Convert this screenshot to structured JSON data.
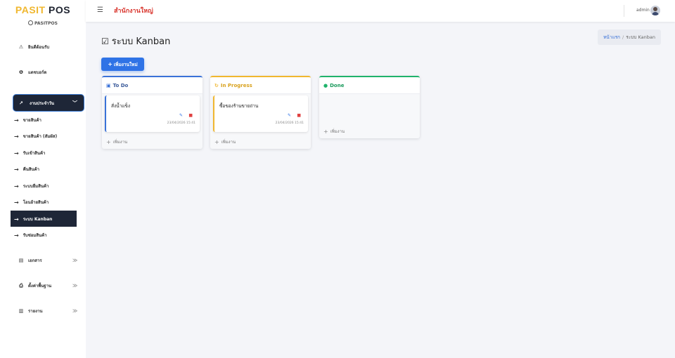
{
  "brand": {
    "name_part1": "PASIT",
    "name_part2": " POS",
    "sub": "PASITPOS"
  },
  "sidebar": {
    "welcome": "ยินดีต้อนรับ",
    "dashboard": "แดชบอร์ด",
    "group_label": "งานประจำวัน",
    "sub_items": [
      "ขายสินค้า",
      "ขายสินค้า (สัมผัส)",
      "รับเข้าสินค้า",
      "คืนสินค้า",
      "ระบบยืมสินค้า",
      "โอนย้ายสินค้า",
      "ระบบ Kanban",
      "รับซ่อมสินค้า"
    ],
    "documents": "เอกสาร",
    "settings": "ตั้งค่าพื้นฐาน",
    "reports": "รายงาน"
  },
  "header": {
    "branch": "สำนักงานใหญ่",
    "user": "admin"
  },
  "page": {
    "title": "ระบบ Kanban",
    "breadcrumb_home": "หน้าแรก",
    "breadcrumb_sep": "/",
    "breadcrumb_current": "ระบบ Kanban",
    "add_button": "เพิ่มงานใหม่"
  },
  "columns": [
    {
      "title": "To Do",
      "color": "#3a72d8",
      "card_title": "สั่งน้ำแข็ง",
      "card_time": "23/04/2026 15:41",
      "add_label": "เพิ่มงาน"
    },
    {
      "title": "In Progress",
      "color": "#f0b72f",
      "card_title": "ซื้อของร้านขายถ่าน",
      "card_time": "23/04/2026 15:41",
      "add_label": "เพิ่มงาน"
    },
    {
      "title": "Done",
      "color": "#1fb36b",
      "add_label": "เพิ่มงาน"
    }
  ]
}
